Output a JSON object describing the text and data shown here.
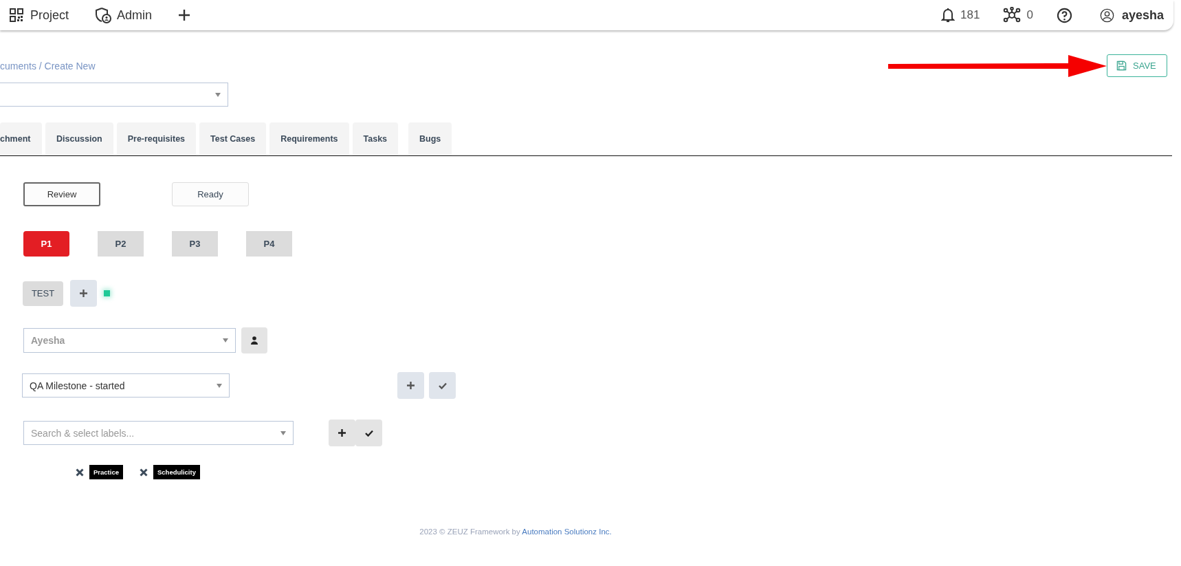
{
  "top_nav": {
    "items": [
      {
        "kind": "project",
        "label": "Project"
      },
      {
        "kind": "admin",
        "label": "Admin"
      },
      {
        "kind": "add"
      }
    ],
    "notifications": "181",
    "connections": "0",
    "user": "ayesha"
  },
  "breadcrumb": "cuments / Create New",
  "save_button": "SAVE",
  "tabs": [
    {
      "label": "chment",
      "selected": false
    },
    {
      "label": "Discussion",
      "selected": false
    },
    {
      "label": "Pre-requisites",
      "selected": false
    },
    {
      "label": "Test Cases",
      "selected": false
    },
    {
      "label": "Requirements",
      "selected": false
    },
    {
      "label": "Tasks",
      "selected": false
    },
    {
      "label": "Bugs",
      "selected": false
    }
  ],
  "status_buttons": [
    {
      "label": "Review",
      "selected": true
    },
    {
      "label": "Ready",
      "selected": false
    }
  ],
  "priorities": [
    {
      "label": "P1",
      "selected": true
    },
    {
      "label": "P2",
      "selected": false
    },
    {
      "label": "P3",
      "selected": false
    },
    {
      "label": "P4",
      "selected": false
    }
  ],
  "tag": "TEST",
  "assignee": {
    "value": "Ayesha"
  },
  "milestone": {
    "value": "QA Milestone - started"
  },
  "labels": {
    "placeholder": "Search & select labels...",
    "selected": [
      "Practice",
      "Schedulicity"
    ]
  },
  "footer": {
    "text": "2023 © ZEUZ Framework by ",
    "link": "Automation Solutionz Inc."
  }
}
